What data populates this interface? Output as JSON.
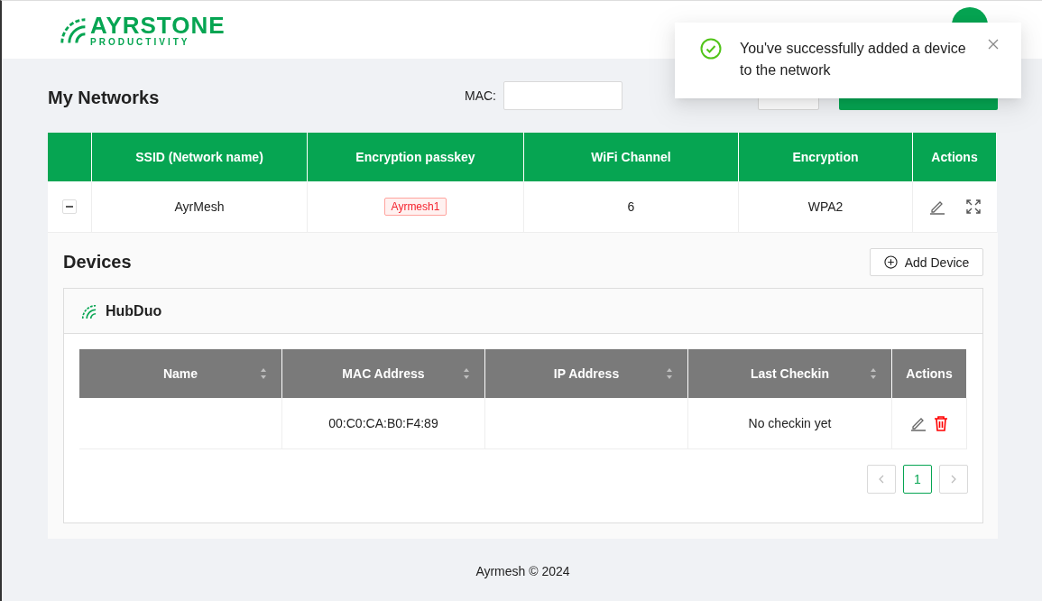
{
  "header": {
    "logo": {
      "title": "AYRSTONE",
      "subtitle": "PRODUCTIVITY"
    }
  },
  "toast": {
    "kind": "success",
    "message": "You've successfully added a device to the network"
  },
  "page_title": "My Networks",
  "filters": [
    {
      "label": "MAC:"
    }
  ],
  "networks_table": {
    "columns": [
      "SSID (Network name)",
      "Encryption passkey",
      "WiFi Channel",
      "Encryption",
      "Actions"
    ],
    "rows": [
      {
        "expanded": true,
        "ssid": "AyrMesh",
        "passkey": "Ayrmesh1",
        "channel": "6",
        "encryption": "WPA2"
      }
    ]
  },
  "devices": {
    "title": "Devices",
    "add_button": "Add Device",
    "groups": [
      {
        "name": "HubDuo",
        "columns": [
          {
            "label": "Name",
            "sortable": true
          },
          {
            "label": "MAC Address",
            "sortable": true
          },
          {
            "label": "IP Address",
            "sortable": true
          },
          {
            "label": "Last Checkin",
            "sortable": true
          },
          {
            "label": "Actions",
            "sortable": false
          }
        ],
        "rows": [
          {
            "mac": "00:C0:CA:B0:F4:89",
            "last_checkin": "No checkin yet"
          }
        ],
        "pages": [
          {
            "label": "1",
            "selected": true
          }
        ]
      }
    ]
  },
  "footer": "Ayrmesh © 2024"
}
